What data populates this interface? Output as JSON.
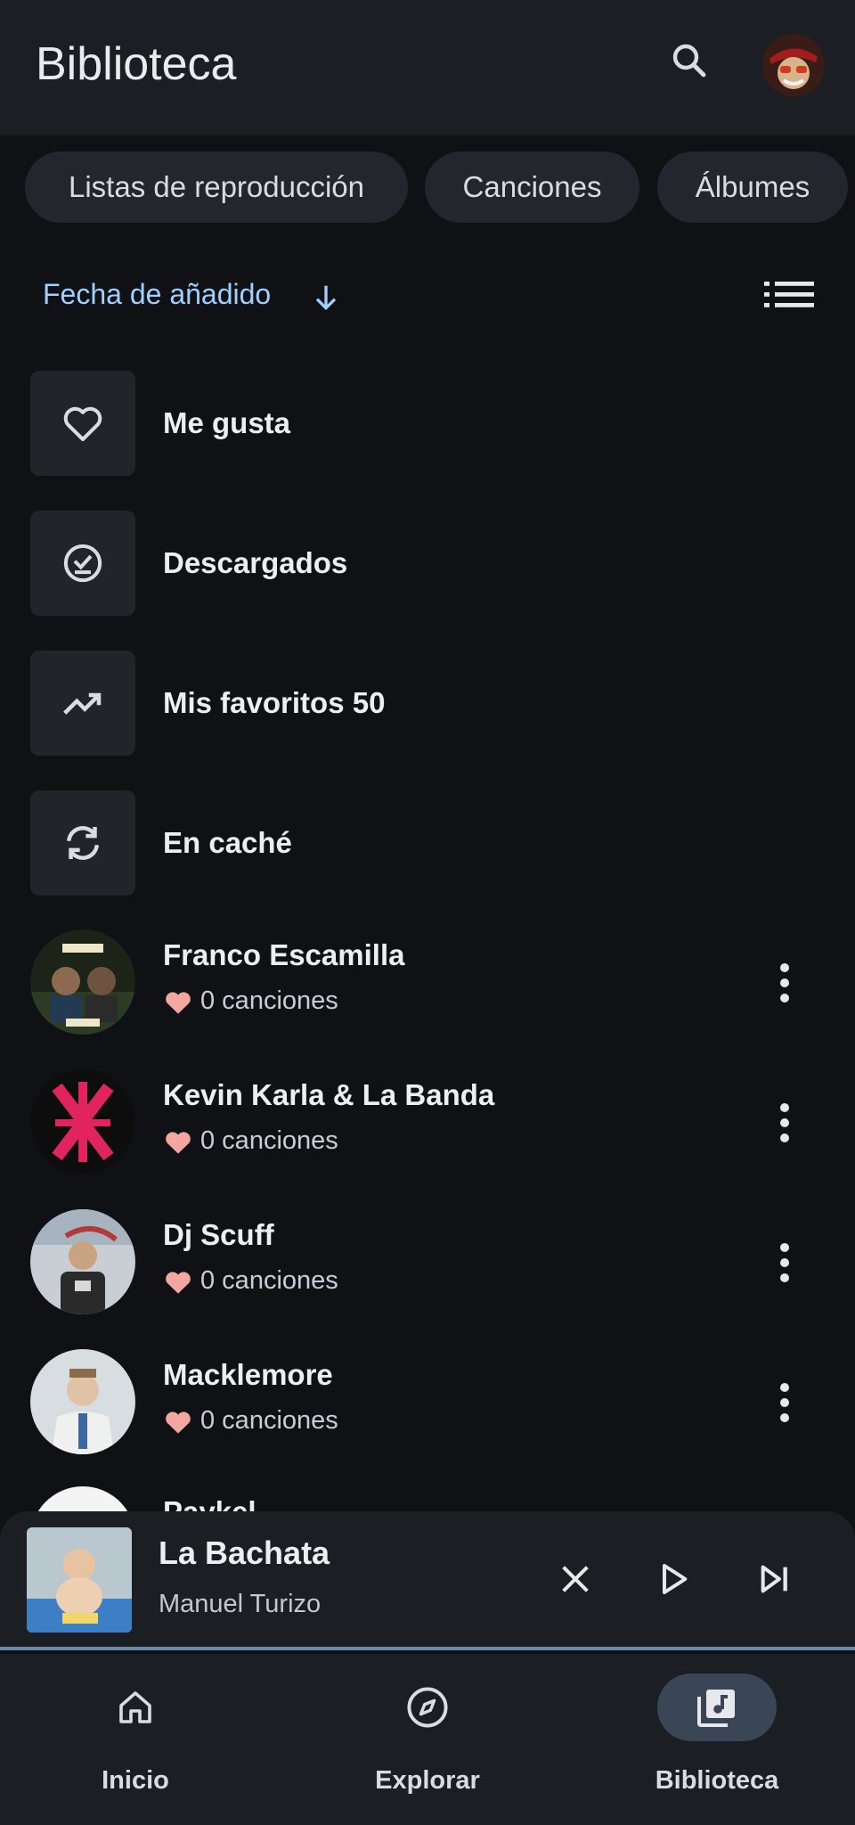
{
  "header": {
    "title": "Biblioteca"
  },
  "chips": [
    {
      "label": "Listas de reproducción"
    },
    {
      "label": "Canciones"
    },
    {
      "label": "Álbumes"
    }
  ],
  "sort": {
    "label": "Fecha de añadido"
  },
  "library_items": [
    {
      "label": "Me gusta",
      "icon": "heart-outline-icon"
    },
    {
      "label": "Descargados",
      "icon": "downloaded-check-icon"
    },
    {
      "label": "Mis favoritos 50",
      "icon": "trending-up-icon"
    },
    {
      "label": "En caché",
      "icon": "sync-icon"
    }
  ],
  "artists": [
    {
      "name": "Franco Escamilla",
      "count": "0 canciones"
    },
    {
      "name": "Kevin Karla & La Banda",
      "count": "0 canciones"
    },
    {
      "name": "Dj Scuff",
      "count": "0 canciones"
    },
    {
      "name": "Macklemore",
      "count": "0 canciones"
    },
    {
      "name": "Paykel"
    }
  ],
  "player": {
    "song": "La Bachata",
    "artist": "Manuel Turizo"
  },
  "nav": [
    {
      "label": "Inicio"
    },
    {
      "label": "Explorar"
    },
    {
      "label": "Biblioteca"
    }
  ],
  "colors": {
    "accent": "#9fd0ff",
    "heart": "#f4a7a0",
    "background": "#0f1115",
    "surface": "#1b1e23"
  }
}
